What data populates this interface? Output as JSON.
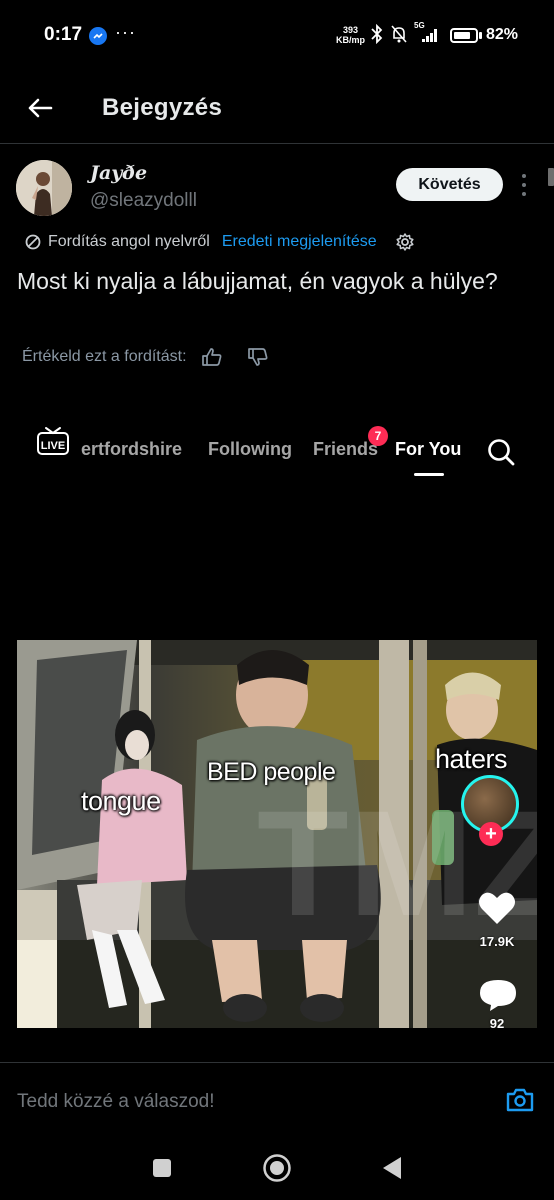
{
  "status_bar": {
    "time": "0:17",
    "dots": "···",
    "net_speed_top": "393",
    "net_speed_bottom": "KB/mp",
    "signal_label": "5G",
    "battery_percent": "82%",
    "battery_level": 0.82
  },
  "header": {
    "title": "Bejegyzés"
  },
  "post": {
    "display_name": "Jayðe",
    "handle": "@sleazydolll",
    "follow_label": "Követés",
    "translation_note": "Fordítás angol nyelvről",
    "show_original_label": "Eredeti megjelenítése",
    "text": "Most ki nyalja a lábujjamat, én vagyok a hülye?",
    "rate_translation_label": "Értékeld ezt a fordítást:"
  },
  "embedded_tiktok": {
    "live_label": "LIVE",
    "tabs": [
      "ertfordshire",
      "Following",
      "Friends",
      "For You"
    ],
    "friends_badge": "7",
    "captions": {
      "tongue": "tongue",
      "bed_people": "BED people",
      "haters": "haters"
    },
    "likes_count": "17.9K",
    "comments_count": "92",
    "watermark": "TMZ"
  },
  "reply": {
    "placeholder": "Tedd közzé a válaszod!"
  },
  "colors": {
    "accent": "#1d9bf0",
    "tiktok_red": "#fe2c55",
    "tiktok_cyan": "#25f4ee",
    "background": "#000000"
  }
}
